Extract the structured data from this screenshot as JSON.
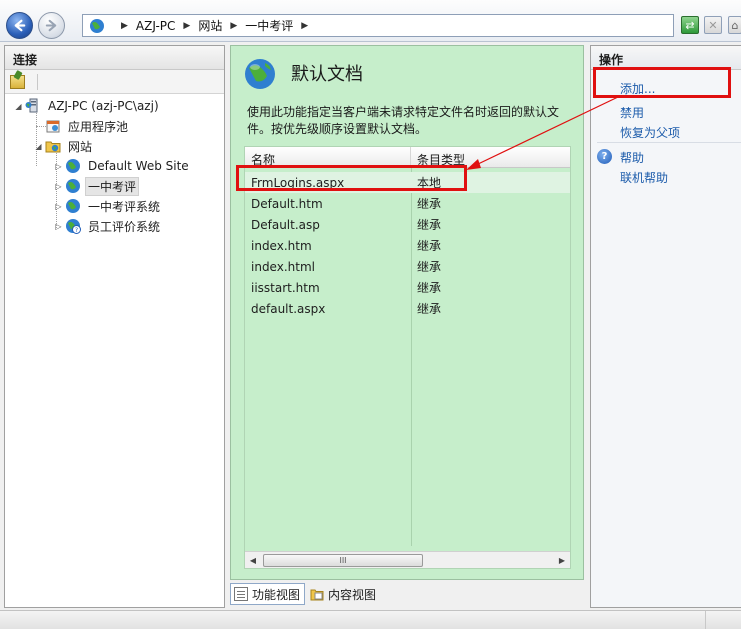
{
  "address_bar": {
    "crumbs": [
      "AZJ-PC",
      "网站",
      "一中考评"
    ]
  },
  "connections": {
    "title": "连接",
    "tree": [
      {
        "label": "AZJ-PC (azj-PC\\azj)",
        "icon": "server-icon"
      },
      {
        "label": "应用程序池",
        "icon": "app-pool-icon"
      },
      {
        "label": "网站",
        "icon": "sites-folder-icon"
      },
      {
        "label": "Default Web Site",
        "icon": "globe-icon"
      },
      {
        "label": "一中考评",
        "icon": "globe-icon"
      },
      {
        "label": "一中考评系统",
        "icon": "globe-icon"
      },
      {
        "label": "员工评价系统",
        "icon": "globe-question-icon"
      }
    ]
  },
  "feature": {
    "title": "默认文档",
    "description": "使用此功能指定当客户端未请求特定文件名时返回的默认文件。按优先级顺序设置默认文档。",
    "columns": {
      "name": "名称",
      "type": "条目类型"
    },
    "rows": [
      {
        "name": "FrmLogins.aspx",
        "type": "本地"
      },
      {
        "name": "Default.htm",
        "type": "继承"
      },
      {
        "name": "Default.asp",
        "type": "继承"
      },
      {
        "name": "index.htm",
        "type": "继承"
      },
      {
        "name": "index.html",
        "type": "继承"
      },
      {
        "name": "iisstart.htm",
        "type": "继承"
      },
      {
        "name": "default.aspx",
        "type": "继承"
      }
    ],
    "scroll_grip": "III"
  },
  "view_tabs": {
    "features_view": "功能视图",
    "content_view": "内容视图"
  },
  "actions": {
    "title": "操作",
    "add": "添加...",
    "disable": "禁用",
    "revert": "恢复为父项",
    "help": "帮助",
    "online_help": "联机帮助"
  },
  "colors": {
    "annotation": "#e01010",
    "feature_bg": "#c6eecb",
    "link": "#1d5cab"
  }
}
